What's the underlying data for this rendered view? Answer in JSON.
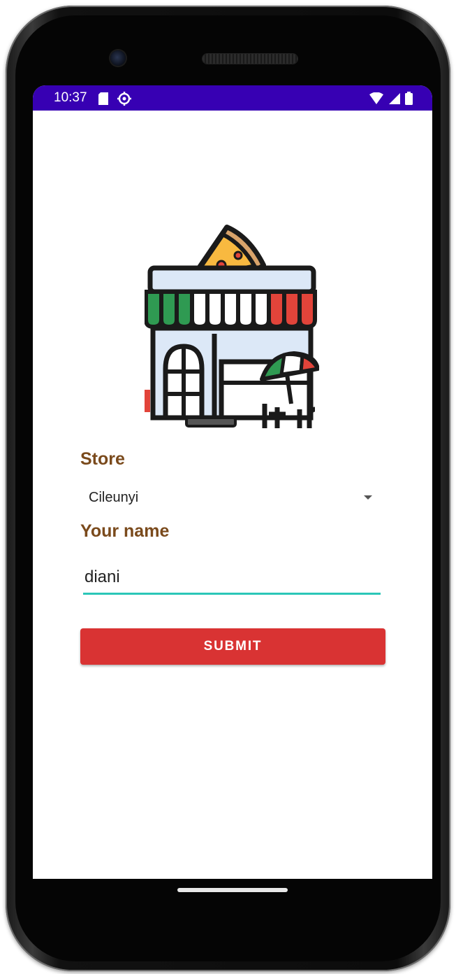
{
  "status_bar": {
    "time": "10:37",
    "icons": [
      "sd-card-icon",
      "settings-icon",
      "wifi-icon",
      "signal-icon",
      "battery-icon"
    ],
    "background_color": "#3700b3"
  },
  "illustration": {
    "icon": "pizza-store-icon"
  },
  "form": {
    "store_label": "Store",
    "store_selected": "Cileunyi",
    "name_label": "Your name",
    "name_value": "diani",
    "submit_label": "SUBMIT"
  },
  "colors": {
    "label_color": "#7a4a1c",
    "accent": "#2bc7b8",
    "submit_bg": "#d93333"
  }
}
